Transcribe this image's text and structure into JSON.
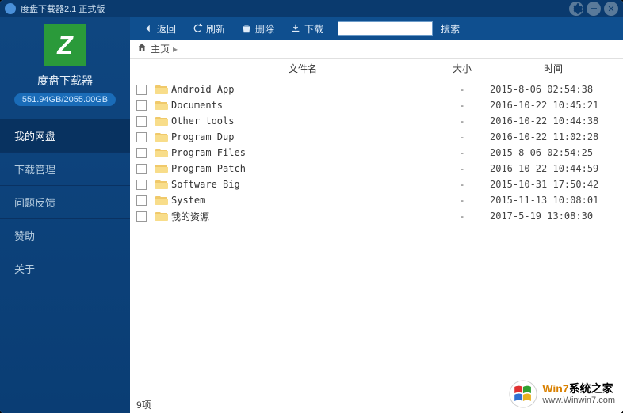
{
  "titlebar": {
    "title": "度盘下载器2.1 正式版"
  },
  "sidebar": {
    "logo_letter": "Z",
    "app_name": "度盘下载器",
    "storage": "551.94GB/2055.00GB",
    "items": [
      {
        "label": "我的网盘",
        "active": true
      },
      {
        "label": "下载管理",
        "active": false
      },
      {
        "label": "问题反馈",
        "active": false
      },
      {
        "label": "赞助",
        "active": false
      },
      {
        "label": "关于",
        "active": false
      }
    ]
  },
  "toolbar": {
    "back": "返回",
    "refresh": "刷新",
    "delete": "删除",
    "download": "下载",
    "search_placeholder": "",
    "search_btn": "搜索"
  },
  "breadcrumb": {
    "home": "主页"
  },
  "columns": {
    "name": "文件名",
    "size": "大小",
    "time": "时间"
  },
  "files": [
    {
      "name": "Android App",
      "size": "-",
      "time": "2015-8-06 02:54:38"
    },
    {
      "name": "Documents",
      "size": "-",
      "time": "2016-10-22 10:45:21"
    },
    {
      "name": "Other tools",
      "size": "-",
      "time": "2016-10-22 10:44:38"
    },
    {
      "name": "Program Dup",
      "size": "-",
      "time": "2016-10-22 11:02:28"
    },
    {
      "name": "Program Files",
      "size": "-",
      "time": "2015-8-06 02:54:25"
    },
    {
      "name": "Program Patch",
      "size": "-",
      "time": "2016-10-22 10:44:59"
    },
    {
      "name": "Software Big",
      "size": "-",
      "time": "2015-10-31 17:50:42"
    },
    {
      "name": "System",
      "size": "-",
      "time": "2015-11-13 10:08:01"
    },
    {
      "name": "我的资源",
      "size": "-",
      "time": "2017-5-19 13:08:30"
    }
  ],
  "statusbar": {
    "count": "9项"
  },
  "watermark": {
    "brand_prefix": "Win7",
    "brand_suffix": "系统之家",
    "url": "www.Winwin7.com"
  }
}
